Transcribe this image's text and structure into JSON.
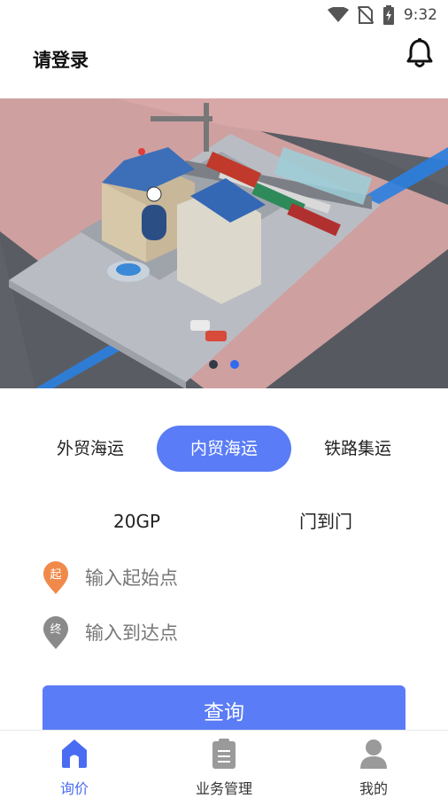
{
  "status_bar": {
    "time": "9:32"
  },
  "header": {
    "title": "请登录"
  },
  "banner": {
    "slide_count": 2,
    "active_slide": 2
  },
  "tabs": [
    {
      "label": "外贸海运",
      "active": false
    },
    {
      "label": "内贸海运",
      "active": true
    },
    {
      "label": "铁路集运",
      "active": false
    }
  ],
  "options": {
    "container_type": "20GP",
    "service_mode": "门到门"
  },
  "origin": {
    "pin_label": "起",
    "placeholder": "输入起始点",
    "value": ""
  },
  "destination": {
    "pin_label": "终",
    "placeholder": "输入到达点",
    "value": ""
  },
  "query_button": {
    "label": "查询"
  },
  "bottom_nav": [
    {
      "label": "询价",
      "icon": "home-icon",
      "active": true
    },
    {
      "label": "业务管理",
      "icon": "clipboard-icon",
      "active": false
    },
    {
      "label": "我的",
      "icon": "person-icon",
      "active": false
    }
  ],
  "colors": {
    "accent": "#5a7cf6",
    "origin_pin": "#f08a4b",
    "destination_pin": "#8a8a8a",
    "nav_active": "#4a6cf3"
  }
}
